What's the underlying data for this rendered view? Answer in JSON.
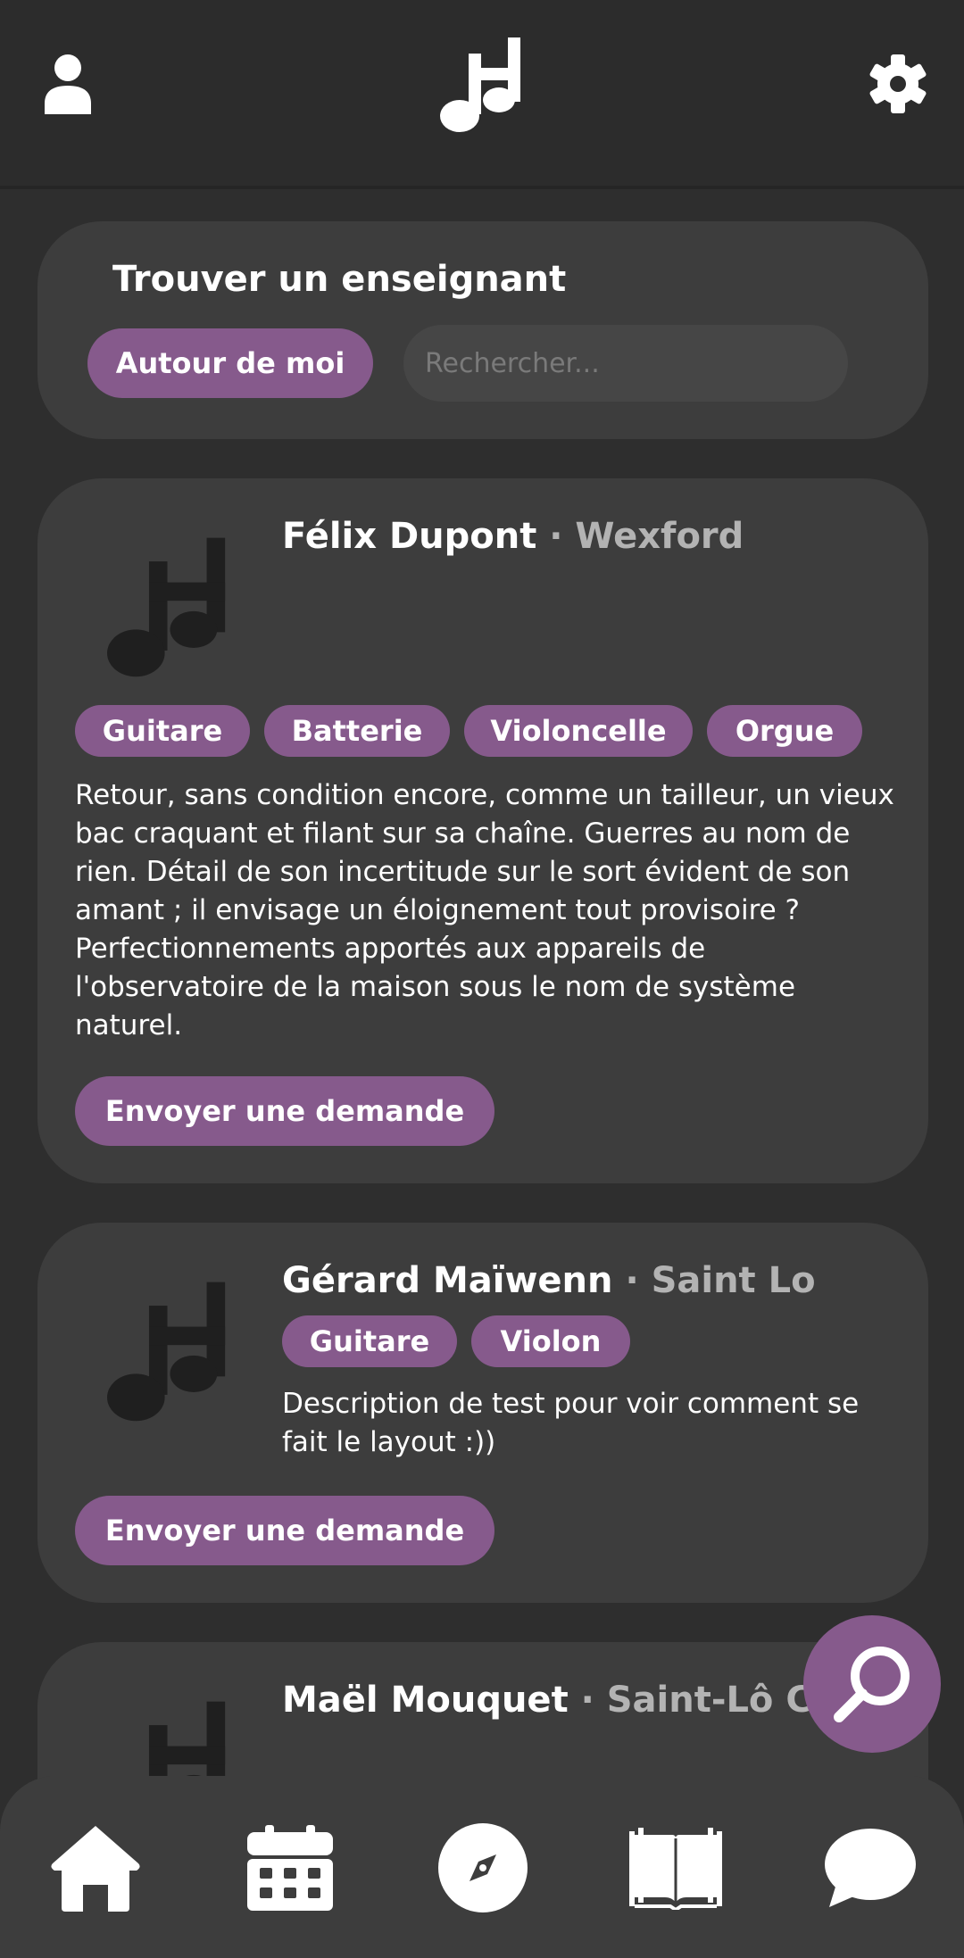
{
  "header": {
    "profile_icon": "user-icon",
    "logo_icon": "music-note-icon",
    "settings_icon": "gear-icon"
  },
  "search": {
    "title": "Trouver un enseignant",
    "near_me_label": "Autour de moi",
    "placeholder": "Rechercher..."
  },
  "teachers": [
    {
      "name": "Félix Dupont",
      "separator": " · ",
      "city": "Wexford",
      "tags": [
        "Guitare",
        "Batterie",
        "Violoncelle",
        "Orgue"
      ],
      "description_lines": [
        "Retour, sans condition encore, comme un tailleur, un vieux",
        "bac craquant et filant sur sa chaîne. Guerres au nom de",
        "rien. Détail de son incertitude sur le sort évident de son",
        "amant ; il envisage un éloignement tout provisoire ?",
        "Perfectionnements apportés aux appareils de",
        "l'observatoire de la maison sous le nom de système",
        "naturel."
      ],
      "button": "Envoyer une demande"
    },
    {
      "name": "Gérard Maïwenn",
      "separator": " · ",
      "city": "Saint Lo",
      "tags": [
        "Guitare",
        "Violon"
      ],
      "description_lines": [
        "Description de test pour voir comment se",
        "fait le layout :))"
      ],
      "button": "Envoyer une demande"
    },
    {
      "name": "Maël Mouquet",
      "separator": " · ",
      "city": "Saint-Lô City"
    }
  ],
  "fab_icon": "search-icon",
  "nav": [
    "home-icon",
    "calendar-icon",
    "compass-icon",
    "book-icon",
    "chat-icon"
  ],
  "colors": {
    "accent": "#865a8c",
    "card": "#3d3d3d",
    "background": "#2e2e2e"
  }
}
